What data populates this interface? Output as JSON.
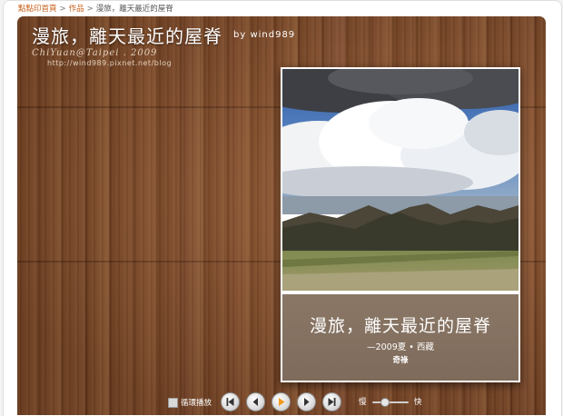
{
  "breadcrumb": {
    "items": [
      "點點印首頁",
      "作品"
    ],
    "separator": ">",
    "current": "漫旅，離天最近的屋脊"
  },
  "header": {
    "title": "漫旅，離天最近的屋脊",
    "byline": "by wind989",
    "watermark": "ChiYuan@Taipei . 2009",
    "watermark_url": "http://wind989.pixnet.net/blog"
  },
  "album": {
    "title": "漫旅，離天最近的屋脊",
    "subtitle": "—2009夏 • 西藏",
    "author": "奇祿",
    "caption_color": "#85715f"
  },
  "controls": {
    "loop_label": "循環播放",
    "loop_checked": false,
    "speed_slow_label": "慢",
    "speed_fast_label": "快",
    "speed_level": 0.35,
    "buttons": [
      "first-icon",
      "previous-icon",
      "play-icon",
      "next-icon",
      "last-icon"
    ],
    "play_accent": "#f09a1e"
  },
  "colors": {
    "breadcrumb_link": "#c85f1a",
    "wood": "#7f4827"
  }
}
